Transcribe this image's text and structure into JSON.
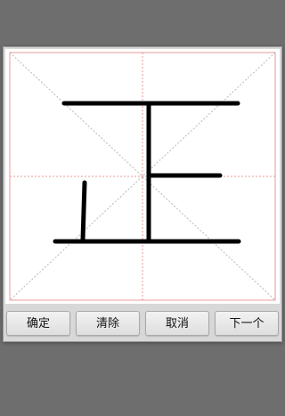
{
  "dialog": {
    "buttons": {
      "confirm": "确定",
      "clear": "清除",
      "cancel": "取消",
      "next": "下一个"
    }
  },
  "colors": {
    "grid_line": "#e99a9a",
    "grid_diagonal": "#b9b9b9",
    "stroke_ink": "#000000",
    "backdrop": "#6e6e6e"
  },
  "canvas": {
    "character_drawn": "正"
  }
}
